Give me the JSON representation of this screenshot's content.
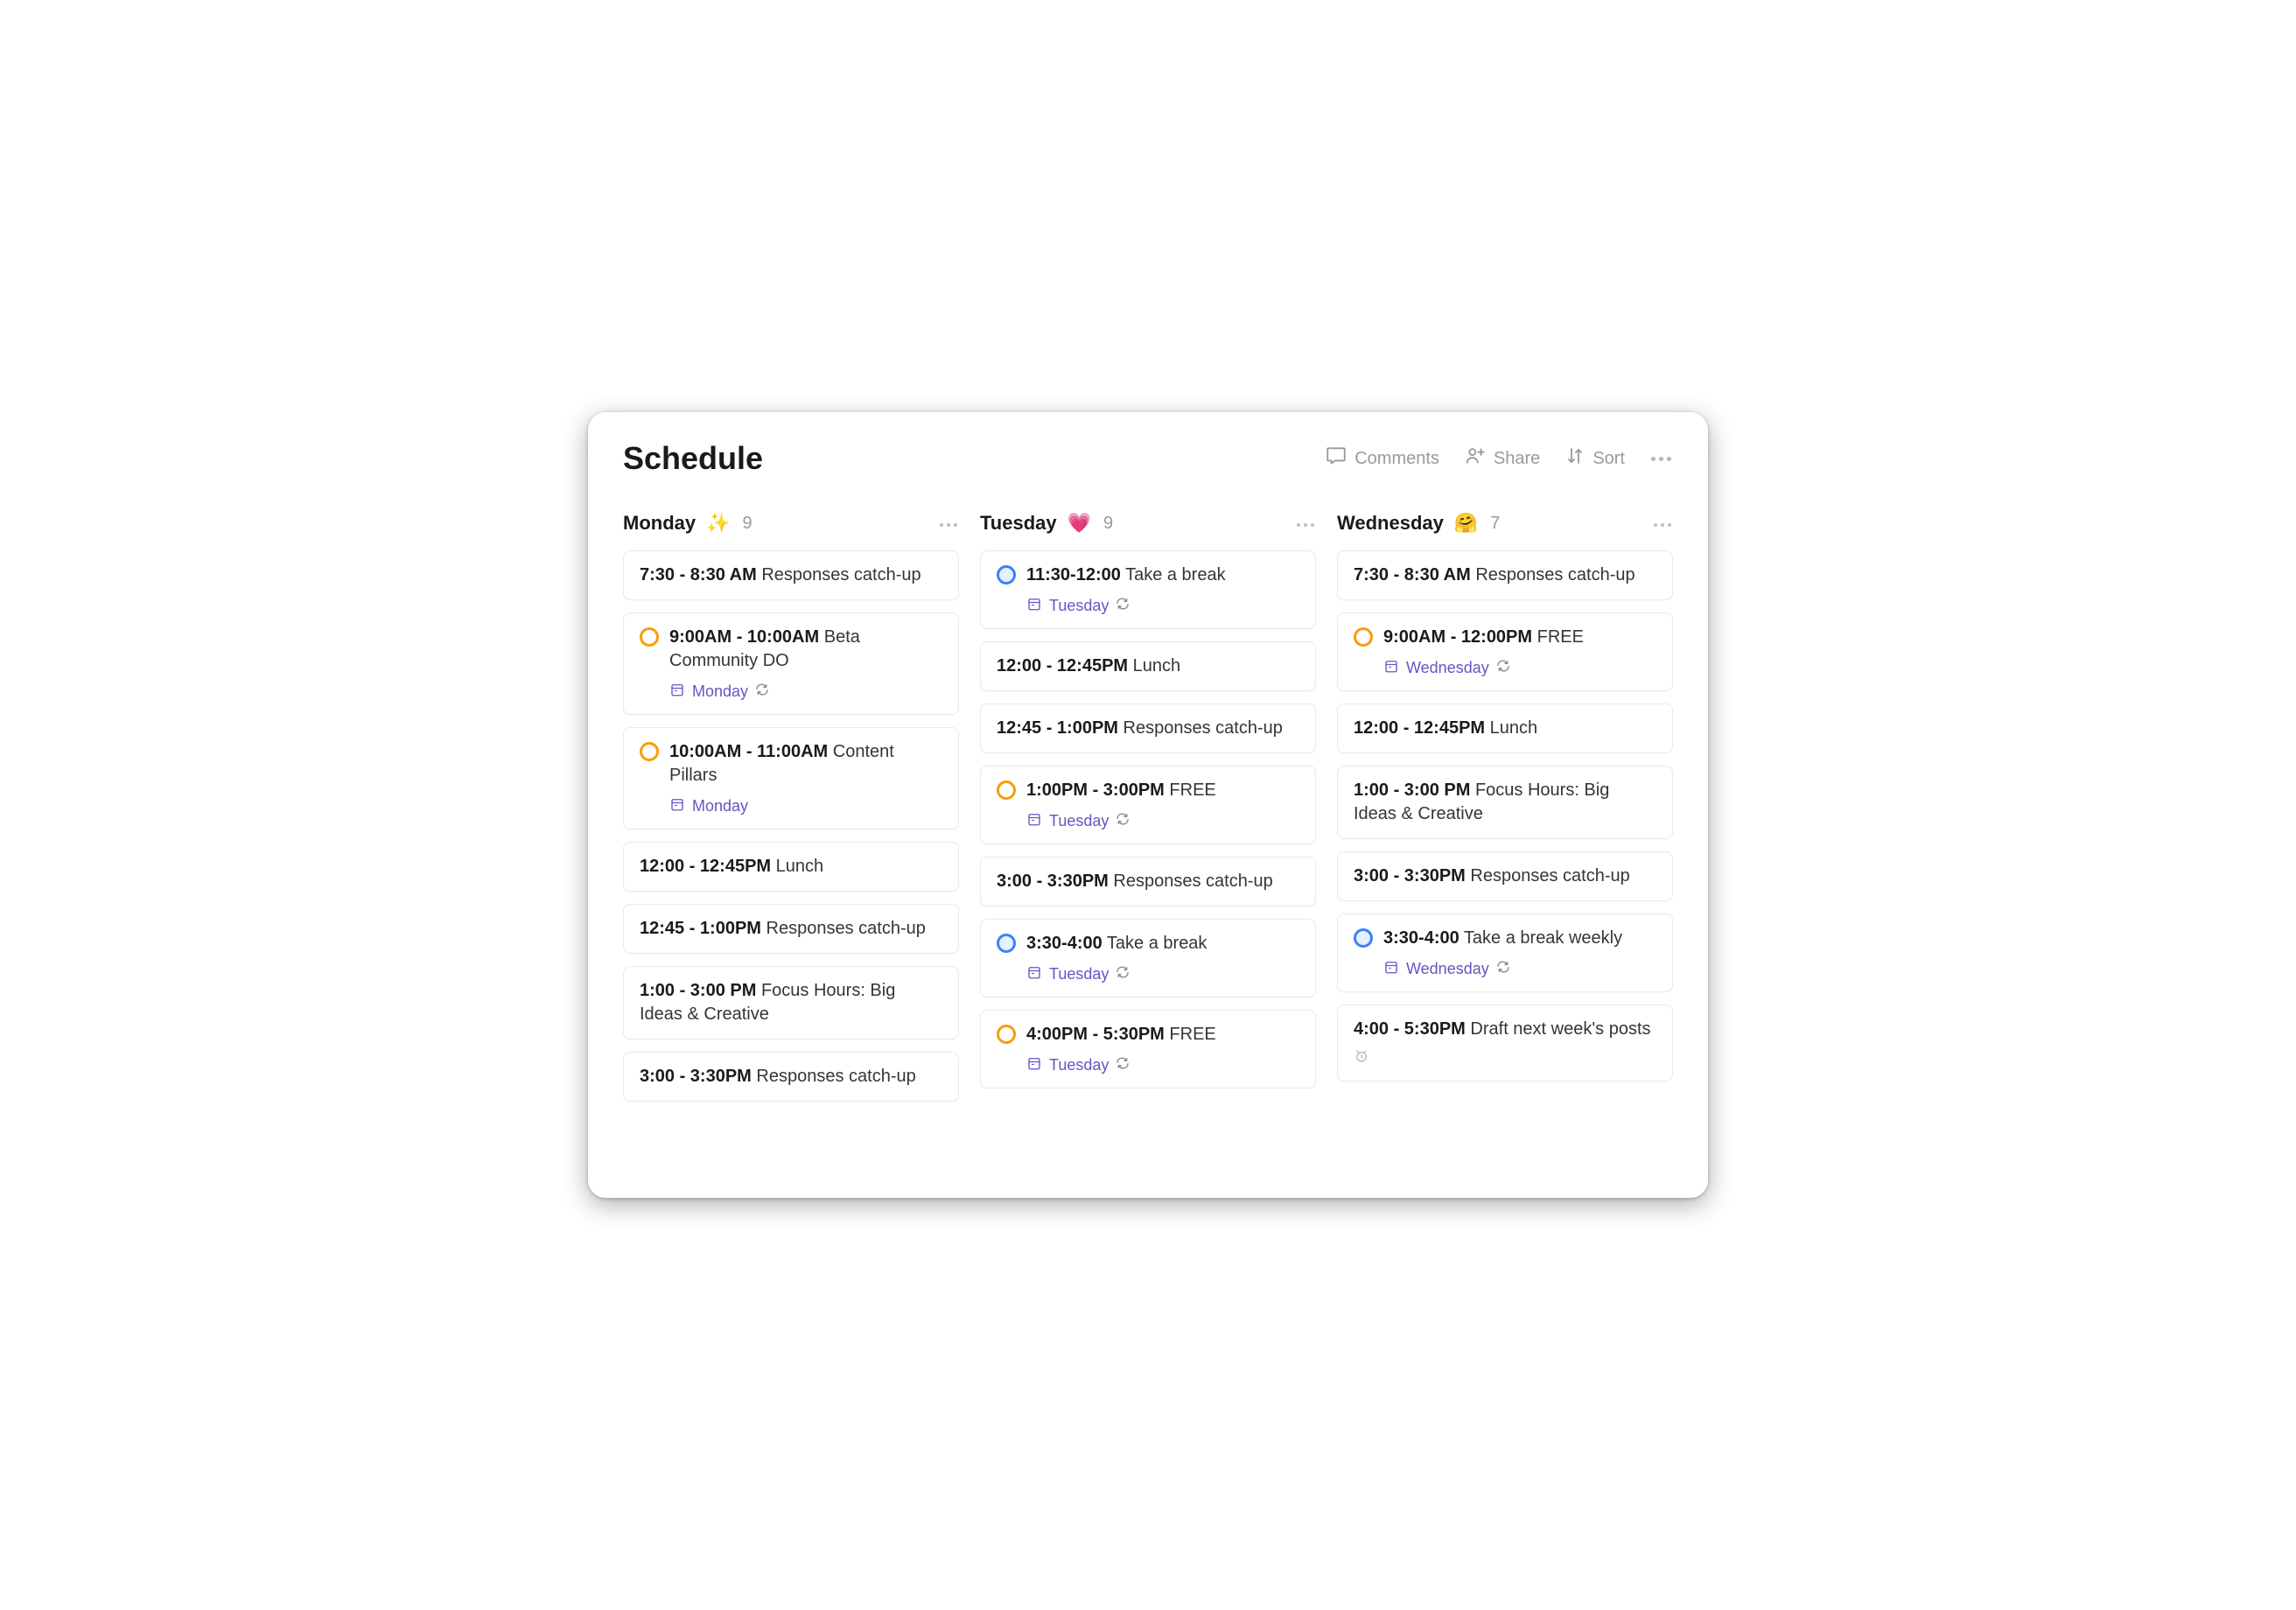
{
  "header": {
    "title": "Schedule",
    "actions": {
      "comments": "Comments",
      "share": "Share",
      "sort": "Sort"
    }
  },
  "columns": [
    {
      "name": "Monday",
      "emoji": "✨",
      "count": "9",
      "cards": [
        {
          "circle": "",
          "time": "7:30 - 8:30 AM",
          "title": "Responses catch-up",
          "tag": "",
          "repeat": false
        },
        {
          "circle": "orange",
          "time": "9:00AM - 10:00AM",
          "title": "Beta Community DO",
          "tag": "Monday",
          "repeat": true
        },
        {
          "circle": "orange",
          "time": "10:00AM - 11:00AM",
          "title": "Content Pillars",
          "tag": "Monday",
          "repeat": false
        },
        {
          "circle": "",
          "time": "12:00 - 12:45PM",
          "title": "Lunch",
          "tag": "",
          "repeat": false
        },
        {
          "circle": "",
          "time": "12:45 - 1:00PM",
          "title": "Responses catch-up",
          "tag": "",
          "repeat": false
        },
        {
          "circle": "",
          "time": "1:00 - 3:00 PM",
          "title": "Focus Hours: Big Ideas & Creative",
          "tag": "",
          "repeat": false
        },
        {
          "circle": "",
          "time": "3:00 - 3:30PM",
          "title": "Responses catch-up",
          "tag": "",
          "repeat": false
        }
      ]
    },
    {
      "name": "Tuesday",
      "emoji": "💗",
      "count": "9",
      "cards": [
        {
          "circle": "blue",
          "time": "11:30-12:00",
          "title": "Take a break",
          "tag": "Tuesday",
          "repeat": true
        },
        {
          "circle": "",
          "time": "12:00 - 12:45PM",
          "title": "Lunch",
          "tag": "",
          "repeat": false
        },
        {
          "circle": "",
          "time": "12:45 - 1:00PM",
          "title": "Responses catch-up",
          "tag": "",
          "repeat": false
        },
        {
          "circle": "orange",
          "time": "1:00PM - 3:00PM",
          "title": "FREE",
          "tag": "Tuesday",
          "repeat": true
        },
        {
          "circle": "",
          "time": "3:00 - 3:30PM",
          "title": "Responses catch-up",
          "tag": "",
          "repeat": false
        },
        {
          "circle": "blue",
          "time": "3:30-4:00",
          "title": "Take a break",
          "tag": "Tuesday",
          "repeat": true
        },
        {
          "circle": "orange",
          "time": "4:00PM - 5:30PM",
          "title": "FREE",
          "tag": "Tuesday",
          "repeat": true
        }
      ]
    },
    {
      "name": "Wednesday",
      "emoji": "🤗",
      "count": "7",
      "cards": [
        {
          "circle": "",
          "time": "7:30 - 8:30 AM",
          "title": "Responses catch-up",
          "tag": "",
          "repeat": false
        },
        {
          "circle": "orange",
          "time": "9:00AM - 12:00PM",
          "title": "FREE",
          "tag": "Wednesday",
          "repeat": true
        },
        {
          "circle": "",
          "time": "12:00 - 12:45PM",
          "title": "Lunch",
          "tag": "",
          "repeat": false
        },
        {
          "circle": "",
          "time": "1:00 - 3:00 PM",
          "title": "Focus Hours: Big Ideas & Creative",
          "tag": "",
          "repeat": false
        },
        {
          "circle": "",
          "time": "3:00 - 3:30PM",
          "title": "Responses catch-up",
          "tag": "",
          "repeat": false
        },
        {
          "circle": "blue",
          "time": "3:30-4:00",
          "title": "Take a break weekly",
          "tag": "Wednesday",
          "repeat": true
        },
        {
          "circle": "",
          "time": "4:00 - 5:30PM",
          "title": "Draft next week's posts",
          "tag": "",
          "repeat": false,
          "clock": true
        }
      ]
    }
  ]
}
